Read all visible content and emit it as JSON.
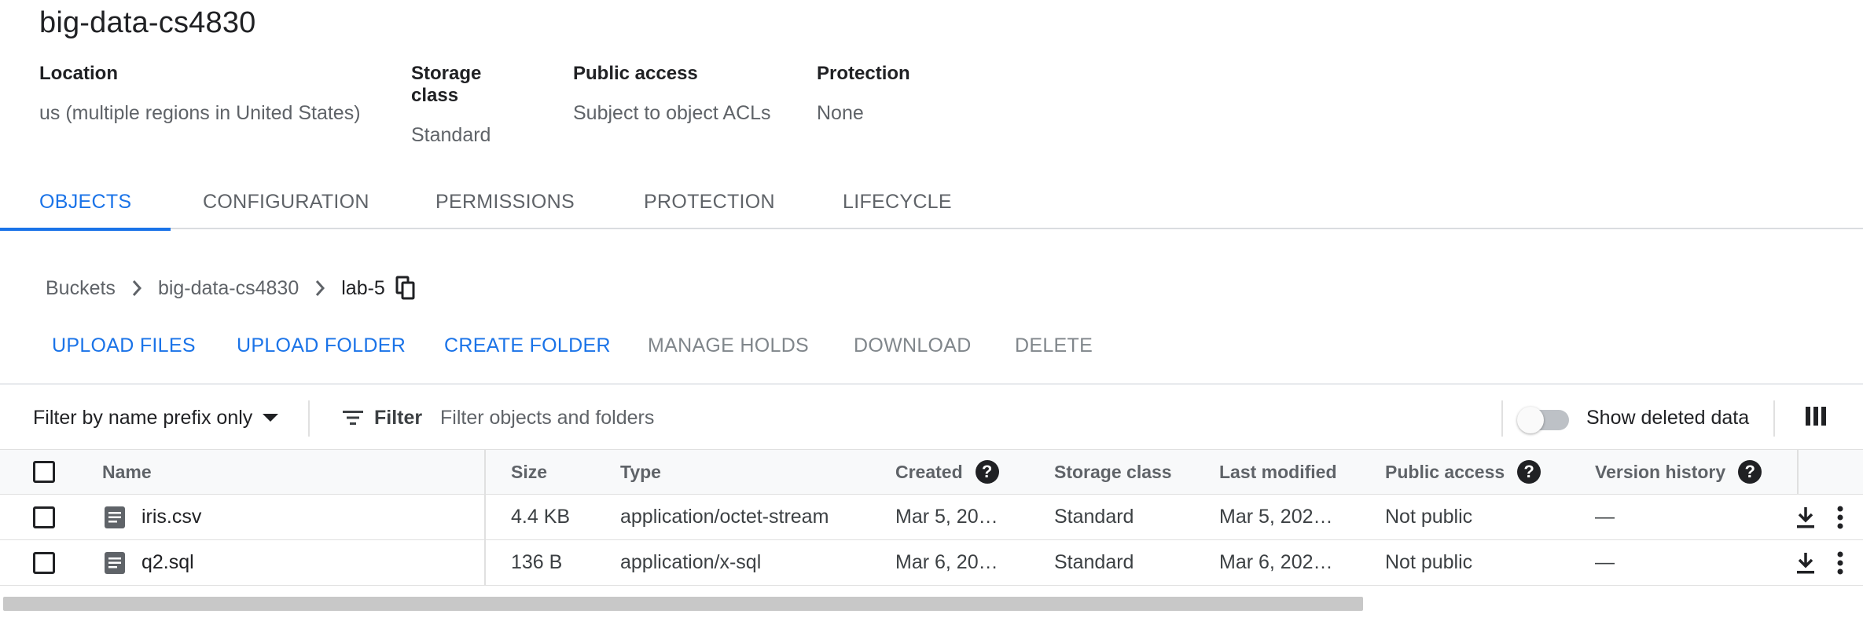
{
  "bucket": {
    "title": "big-data-cs4830"
  },
  "summary": [
    {
      "label": "Location",
      "value": "us (multiple regions in United States)"
    },
    {
      "label": "Storage class",
      "value": "Standard"
    },
    {
      "label": "Public access",
      "value": "Subject to object ACLs"
    },
    {
      "label": "Protection",
      "value": "None"
    }
  ],
  "tabs": [
    {
      "label": "OBJECTS",
      "active": true
    },
    {
      "label": "CONFIGURATION",
      "active": false
    },
    {
      "label": "PERMISSIONS",
      "active": false
    },
    {
      "label": "PROTECTION",
      "active": false
    },
    {
      "label": "LIFECYCLE",
      "active": false
    }
  ],
  "breadcrumb": {
    "items": [
      "Buckets",
      "big-data-cs4830",
      "lab-5"
    ]
  },
  "actions": [
    {
      "label": "UPLOAD FILES",
      "enabled": true
    },
    {
      "label": "UPLOAD FOLDER",
      "enabled": true
    },
    {
      "label": "CREATE FOLDER",
      "enabled": true
    },
    {
      "label": "MANAGE HOLDS",
      "enabled": false
    },
    {
      "label": "DOWNLOAD",
      "enabled": false
    },
    {
      "label": "DELETE",
      "enabled": false
    }
  ],
  "filterbar": {
    "prefix_label": "Filter by name prefix only",
    "filter_label": "Filter",
    "placeholder": "Filter objects and folders",
    "show_deleted_label": "Show deleted data",
    "show_deleted_on": false
  },
  "table": {
    "headers": {
      "name": "Name",
      "size": "Size",
      "type": "Type",
      "created": "Created",
      "storage_class": "Storage class",
      "last_modified": "Last modified",
      "public_access": "Public access",
      "version_history": "Version history"
    },
    "rows": [
      {
        "name": "iris.csv",
        "size": "4.4 KB",
        "type": "application/octet-stream",
        "created": "Mar 5, 20…",
        "storage_class": "Standard",
        "last_modified": "Mar 5, 202…",
        "public_access": "Not public",
        "version_history": "—"
      },
      {
        "name": "q2.sql",
        "size": "136 B",
        "type": "application/x-sql",
        "created": "Mar 6, 20…",
        "storage_class": "Standard",
        "last_modified": "Mar 6, 202…",
        "public_access": "Not public",
        "version_history": "—"
      }
    ]
  },
  "colors": {
    "accent": "#1a73e8",
    "text_primary": "#202124",
    "text_secondary": "#5f6368",
    "disabled": "#80868b"
  }
}
